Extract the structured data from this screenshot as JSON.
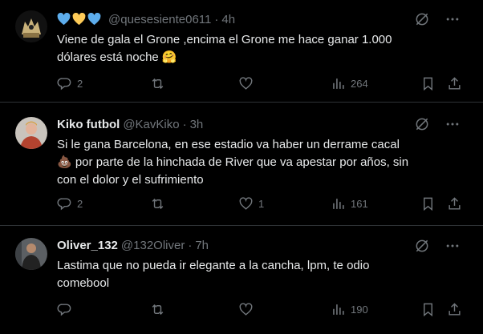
{
  "colors": {
    "background": "#000000",
    "text": "#e7e9ea",
    "muted": "#71767b",
    "divider": "#2f3336"
  },
  "tweets": [
    {
      "badges": [
        "blue-heart",
        "yellow-heart",
        "blue-heart"
      ],
      "name": "",
      "handle": "@quesesiente0611",
      "dot": "·",
      "time": "4h",
      "text_lines": [
        "Viene de gala el Grone ,encima el Grone me hace ganar 1.000",
        "dólares está noche 🤗"
      ],
      "replies": "2",
      "retweets": "",
      "likes": "",
      "views": "264"
    },
    {
      "name": "Kiko futbol",
      "handle": "@KavKiko",
      "dot": "·",
      "time": "3h",
      "text_lines": [
        "Si le gana Barcelona, en ese estadio va haber un derrame cacal",
        "💩 por parte de la hinchada de River que va  apestar por años, sin",
        "con el dolor y el sufrimiento"
      ],
      "replies": "2",
      "retweets": "",
      "likes": "1",
      "views": "161"
    },
    {
      "name": "Oliver_132",
      "handle": "@132Oliver",
      "dot": "·",
      "time": "7h",
      "text_lines": [
        "Lastima que no pueda ir elegante a la cancha, lpm, te odio",
        "comebool"
      ],
      "replies": "",
      "retweets": "",
      "likes": "",
      "views": "190"
    }
  ],
  "icons": [
    "grok-icon",
    "more-icon",
    "reply-icon",
    "retweet-icon",
    "like-icon",
    "views-icon",
    "bookmark-icon",
    "share-icon"
  ]
}
